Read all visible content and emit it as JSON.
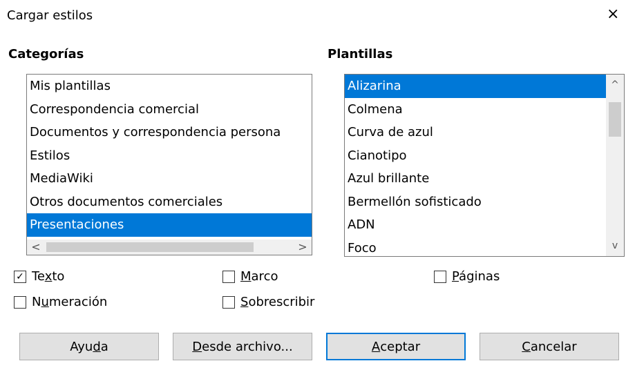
{
  "dialog": {
    "title": "Cargar estilos",
    "close_symbol": "×"
  },
  "categories": {
    "label": "Categorías",
    "items": [
      "Mis plantillas",
      "Correspondencia comercial",
      "Documentos y correspondencia persona",
      "Estilos",
      "MediaWiki",
      "Otros documentos comerciales",
      "Presentaciones"
    ],
    "selected_index": 6,
    "scroll_left": "<",
    "scroll_right": ">"
  },
  "templates": {
    "label": "Plantillas",
    "items": [
      "Alizarina",
      "Colmena",
      "Curva de azul",
      "Cianotipo",
      "Azul brillante",
      "Bermellón sofisticado",
      "ADN",
      "Foco"
    ],
    "selected_index": 0,
    "scroll_up": "^",
    "scroll_down": "v"
  },
  "options": {
    "texto": {
      "label_pre": "Te",
      "label_u": "x",
      "label_post": "to",
      "checked": true
    },
    "marco": {
      "label_pre": "",
      "label_u": "M",
      "label_post": "arco",
      "checked": false
    },
    "paginas": {
      "label_pre": "",
      "label_u": "P",
      "label_post": "áginas",
      "checked": false
    },
    "numeracion": {
      "label_pre": "N",
      "label_u": "u",
      "label_post": "meración",
      "checked": false
    },
    "sobrescribir": {
      "label_pre": "",
      "label_u": "S",
      "label_post": "obrescribir",
      "checked": false
    }
  },
  "buttons": {
    "ayuda": {
      "pre": "Ayu",
      "u": "d",
      "post": "a"
    },
    "desde_archivo": {
      "pre": "",
      "u": "D",
      "post": "esde archivo..."
    },
    "aceptar": {
      "pre": "",
      "u": "A",
      "post": "ceptar"
    },
    "cancelar": {
      "pre": "",
      "u": "C",
      "post": "ancelar"
    }
  },
  "colors": {
    "selection": "#0078d7",
    "button_bg": "#e1e1e1"
  }
}
